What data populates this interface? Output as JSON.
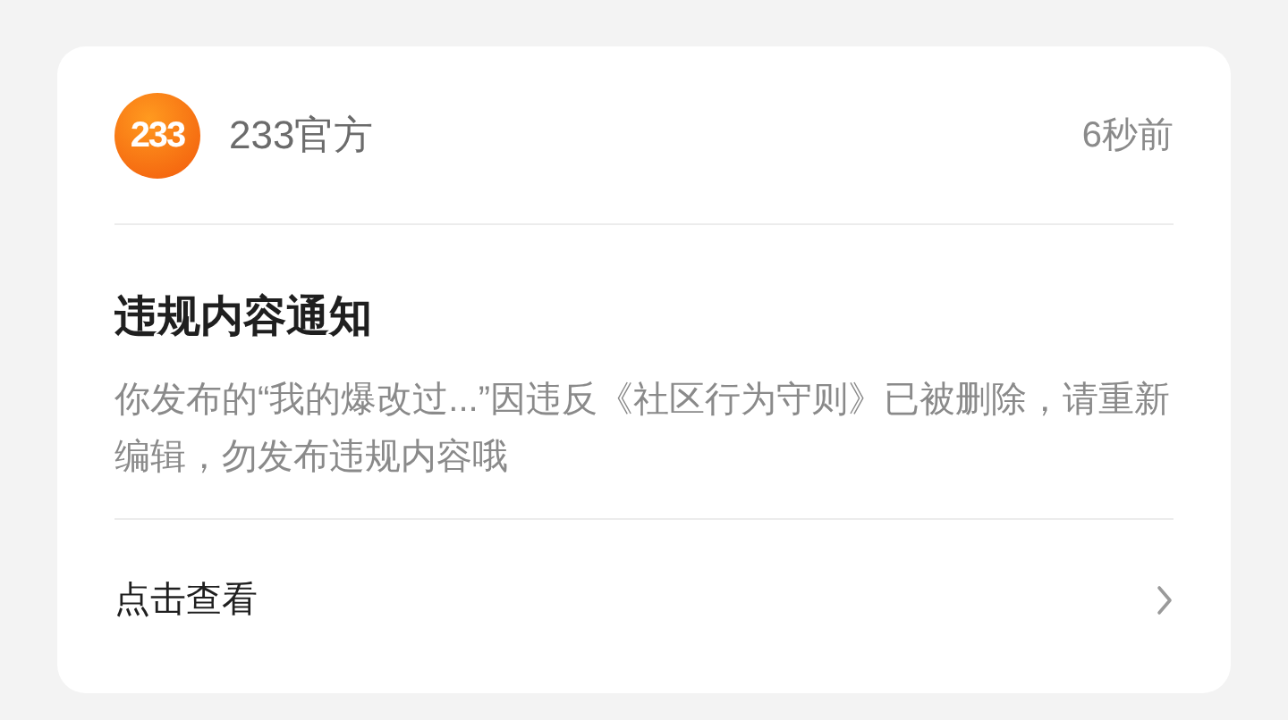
{
  "sender": {
    "logo_text": "233",
    "name": "233官方",
    "time": "6秒前"
  },
  "notice": {
    "title": "违规内容通知",
    "body": "你发布的“我的爆改过...”因违反《社区行为守则》已被删除，请重新编辑，勿发布违规内容哦"
  },
  "action": {
    "label": "点击查看"
  }
}
